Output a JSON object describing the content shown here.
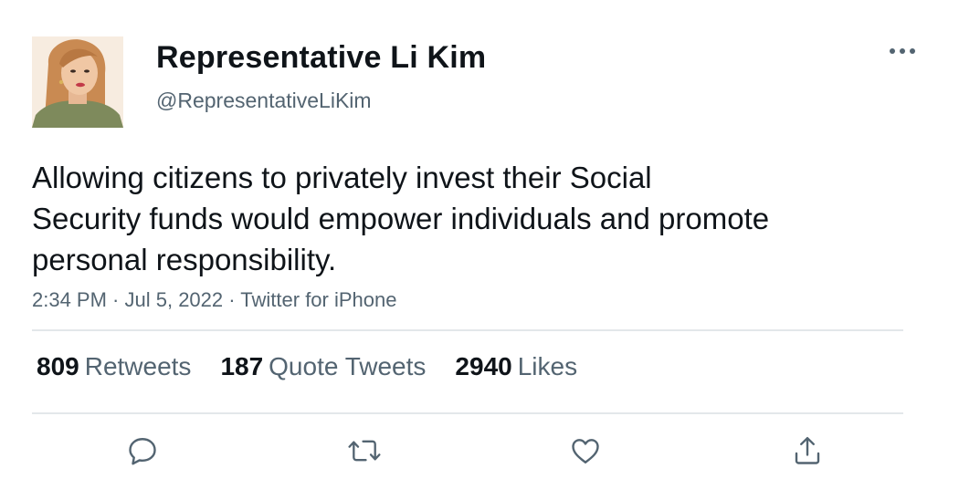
{
  "author": {
    "display_name": "Representative Li Kim",
    "handle": "@RepresentativeLiKim"
  },
  "tweet": {
    "text_lines": [
      "Allowing citizens to privately invest their Social",
      "Security funds would empower individuals and promote",
      "personal responsibility."
    ],
    "time": "2:34 PM",
    "date": "Jul 5, 2022",
    "source": "Twitter for iPhone",
    "separator": " · "
  },
  "stats": {
    "retweets_count": "809",
    "retweets_label": "Retweets",
    "quotes_count": "187",
    "quotes_label": "Quote Tweets",
    "likes_count": "2940",
    "likes_label": "Likes"
  },
  "icons": {
    "more": "more-dots-icon",
    "reply": "reply-icon",
    "retweet": "retweet-icon",
    "like": "heart-icon",
    "share": "share-icon"
  },
  "colors": {
    "text_primary": "#0f1419",
    "text_secondary": "#536471",
    "divider": "#e3e7ea",
    "icon": "#536471"
  }
}
